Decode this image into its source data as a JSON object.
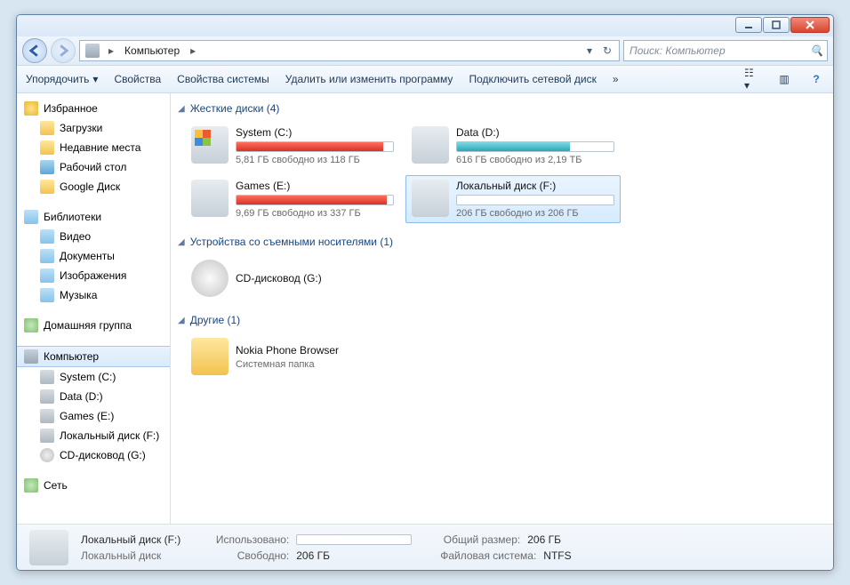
{
  "breadcrumb": {
    "location": "Компьютер",
    "arrow": "▸"
  },
  "search": {
    "placeholder": "Поиск: Компьютер"
  },
  "toolbar": {
    "organize": "Упорядочить",
    "properties": "Свойства",
    "sysprops": "Свойства системы",
    "uninstall": "Удалить или изменить программу",
    "map": "Подключить сетевой диск",
    "more": "»"
  },
  "sidebar": {
    "favorites": {
      "label": "Избранное",
      "items": [
        {
          "label": "Загрузки"
        },
        {
          "label": "Недавние места"
        },
        {
          "label": "Рабочий стол"
        },
        {
          "label": "Google Диск"
        }
      ]
    },
    "libraries": {
      "label": "Библиотеки",
      "items": [
        {
          "label": "Видео"
        },
        {
          "label": "Документы"
        },
        {
          "label": "Изображения"
        },
        {
          "label": "Музыка"
        }
      ]
    },
    "homegroup": {
      "label": "Домашняя группа"
    },
    "computer": {
      "label": "Компьютер",
      "items": [
        {
          "label": "System (C:)"
        },
        {
          "label": "Data (D:)"
        },
        {
          "label": "Games (E:)"
        },
        {
          "label": "Локальный диск (F:)"
        },
        {
          "label": "CD-дисковод (G:)"
        }
      ]
    },
    "network": {
      "label": "Сеть"
    }
  },
  "sections": {
    "hdd": {
      "title": "Жесткие диски (4)",
      "drives": [
        {
          "name": "System (C:)",
          "free": "5,81 ГБ свободно из 118 ГБ",
          "fill": "red",
          "pct": 94,
          "icon": "win"
        },
        {
          "name": "Data (D:)",
          "free": "616 ГБ свободно из 2,19 ТБ",
          "fill": "teal",
          "pct": 72,
          "icon": "hd"
        },
        {
          "name": "Games (E:)",
          "free": "9,69 ГБ свободно из 337 ГБ",
          "fill": "red",
          "pct": 96,
          "icon": "hd"
        },
        {
          "name": "Локальный диск (F:)",
          "free": "206 ГБ свободно из 206 ГБ",
          "fill": "none",
          "pct": 0,
          "icon": "hd",
          "sel": true
        }
      ]
    },
    "removable": {
      "title": "Устройства со съемными носителями (1)",
      "items": [
        {
          "name": "CD-дисковод (G:)"
        }
      ]
    },
    "other": {
      "title": "Другие (1)",
      "items": [
        {
          "name": "Nokia Phone Browser",
          "sub": "Системная папка"
        }
      ]
    }
  },
  "status": {
    "title": "Локальный диск (F:)",
    "subtitle": "Локальный диск",
    "used_lbl": "Использовано:",
    "free_lbl": "Свободно:",
    "free_val": "206 ГБ",
    "total_lbl": "Общий размер:",
    "total_val": "206 ГБ",
    "fs_lbl": "Файловая система:",
    "fs_val": "NTFS"
  }
}
